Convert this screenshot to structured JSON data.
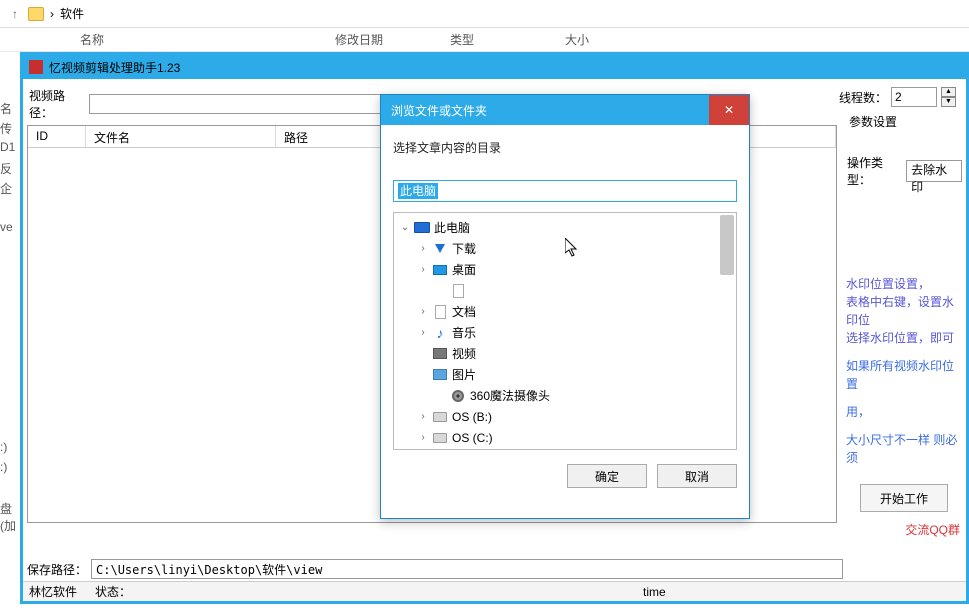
{
  "explorer": {
    "breadcrumb": "软件",
    "columns": {
      "name": "名称",
      "modified": "修改日期",
      "type": "类型",
      "size": "大小"
    }
  },
  "app": {
    "title": "忆视频剪辑处理助手1.23",
    "video_path_label": "视频路径：",
    "thread_label": "线程数：",
    "thread_value": "2",
    "table": {
      "id": "ID",
      "filename": "文件名",
      "path": "路径"
    },
    "params": {
      "title": "参数设置",
      "op_type_label": "操作类型：",
      "op_type_value": "去除水印"
    },
    "help": {
      "line1": "水印位置设置，",
      "line2": "表格中右键，设置水印位",
      "line3": "选择水印位置，即可",
      "line4": "如果所有视频水印位置",
      "line5": "用，",
      "line6": "大小尺寸不一样 则必须"
    },
    "start_btn": "开始工作",
    "qq_link": "交流QQ群",
    "save_label": "保存路径：",
    "save_value": "C:\\Users\\linyi\\Desktop\\软件\\view",
    "status": {
      "brand": "林忆软件",
      "state_label": "状态：",
      "time_label": "time"
    }
  },
  "left_edge": [
    "名",
    "传",
    "D1",
    "反",
    "企",
    "",
    "ve",
    "",
    "",
    "",
    "",
    "",
    "",
    "",
    "",
    "",
    "",
    ":)",
    ":)",
    "",
    "盘 (加"
  ],
  "dialog": {
    "title": "浏览文件或文件夹",
    "instruction": "选择文章内容的目录",
    "selected": "此电脑",
    "tree": [
      {
        "label": "此电脑",
        "icon": "pc",
        "indent": 0,
        "expanded": true
      },
      {
        "label": "下载",
        "icon": "dl",
        "indent": 1,
        "expandable": true
      },
      {
        "label": "桌面",
        "icon": "desk",
        "indent": 1,
        "expandable": true
      },
      {
        "label": "",
        "icon": "doc",
        "indent": 2,
        "expandable": false
      },
      {
        "label": "文档",
        "icon": "doc",
        "indent": 1,
        "expandable": true
      },
      {
        "label": "音乐",
        "icon": "music",
        "indent": 1,
        "expandable": true
      },
      {
        "label": "视频",
        "icon": "video",
        "indent": 1,
        "expandable": false
      },
      {
        "label": "图片",
        "icon": "pic",
        "indent": 1,
        "expandable": false
      },
      {
        "label": "360魔法摄像头",
        "icon": "cam",
        "indent": 2,
        "expandable": false
      },
      {
        "label": "OS (B:)",
        "icon": "drive",
        "indent": 1,
        "expandable": true
      },
      {
        "label": "OS (C:)",
        "icon": "drive",
        "indent": 1,
        "expandable": true
      }
    ],
    "ok": "确定",
    "cancel": "取消"
  }
}
